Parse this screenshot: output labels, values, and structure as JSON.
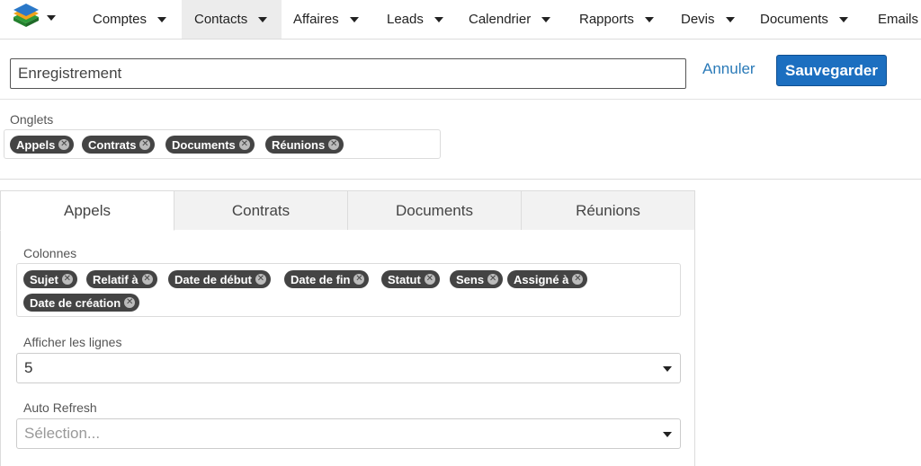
{
  "nav": {
    "items": [
      {
        "label": "Comptes"
      },
      {
        "label": "Contacts"
      },
      {
        "label": "Affaires"
      },
      {
        "label": "Leads"
      },
      {
        "label": "Calendrier"
      },
      {
        "label": "Rapports"
      },
      {
        "label": "Devis"
      },
      {
        "label": "Documents"
      },
      {
        "label": "Emails"
      }
    ],
    "active": "Contacts"
  },
  "header": {
    "name_value": "Enregistrement",
    "cancel_label": "Annuler",
    "save_label": "Sauvegarder"
  },
  "onglets": {
    "label": "Onglets",
    "tags": [
      "Appels",
      "Contrats",
      "Documents",
      "Réunions"
    ]
  },
  "tabs": {
    "items": [
      "Appels",
      "Contrats",
      "Documents",
      "Réunions"
    ],
    "active": "Appels"
  },
  "panel": {
    "colonnes_label": "Colonnes",
    "colonnes": [
      "Sujet",
      "Relatif à",
      "Date de début",
      "Date de fin",
      "Statut",
      "Sens",
      "Assigné à",
      "Date de création"
    ],
    "lignes_label": "Afficher les lignes",
    "lignes_value": "5",
    "refresh_label": "Auto Refresh",
    "refresh_placeholder": "Sélection..."
  },
  "colors": {
    "accent": "#1c6fc0",
    "link": "#2a7ab8",
    "tag_bg": "#444444"
  },
  "icons": {
    "logo": "stacked-layers-logo",
    "dropdown": "caret-down-icon",
    "tag_remove": "close-circle-icon"
  }
}
